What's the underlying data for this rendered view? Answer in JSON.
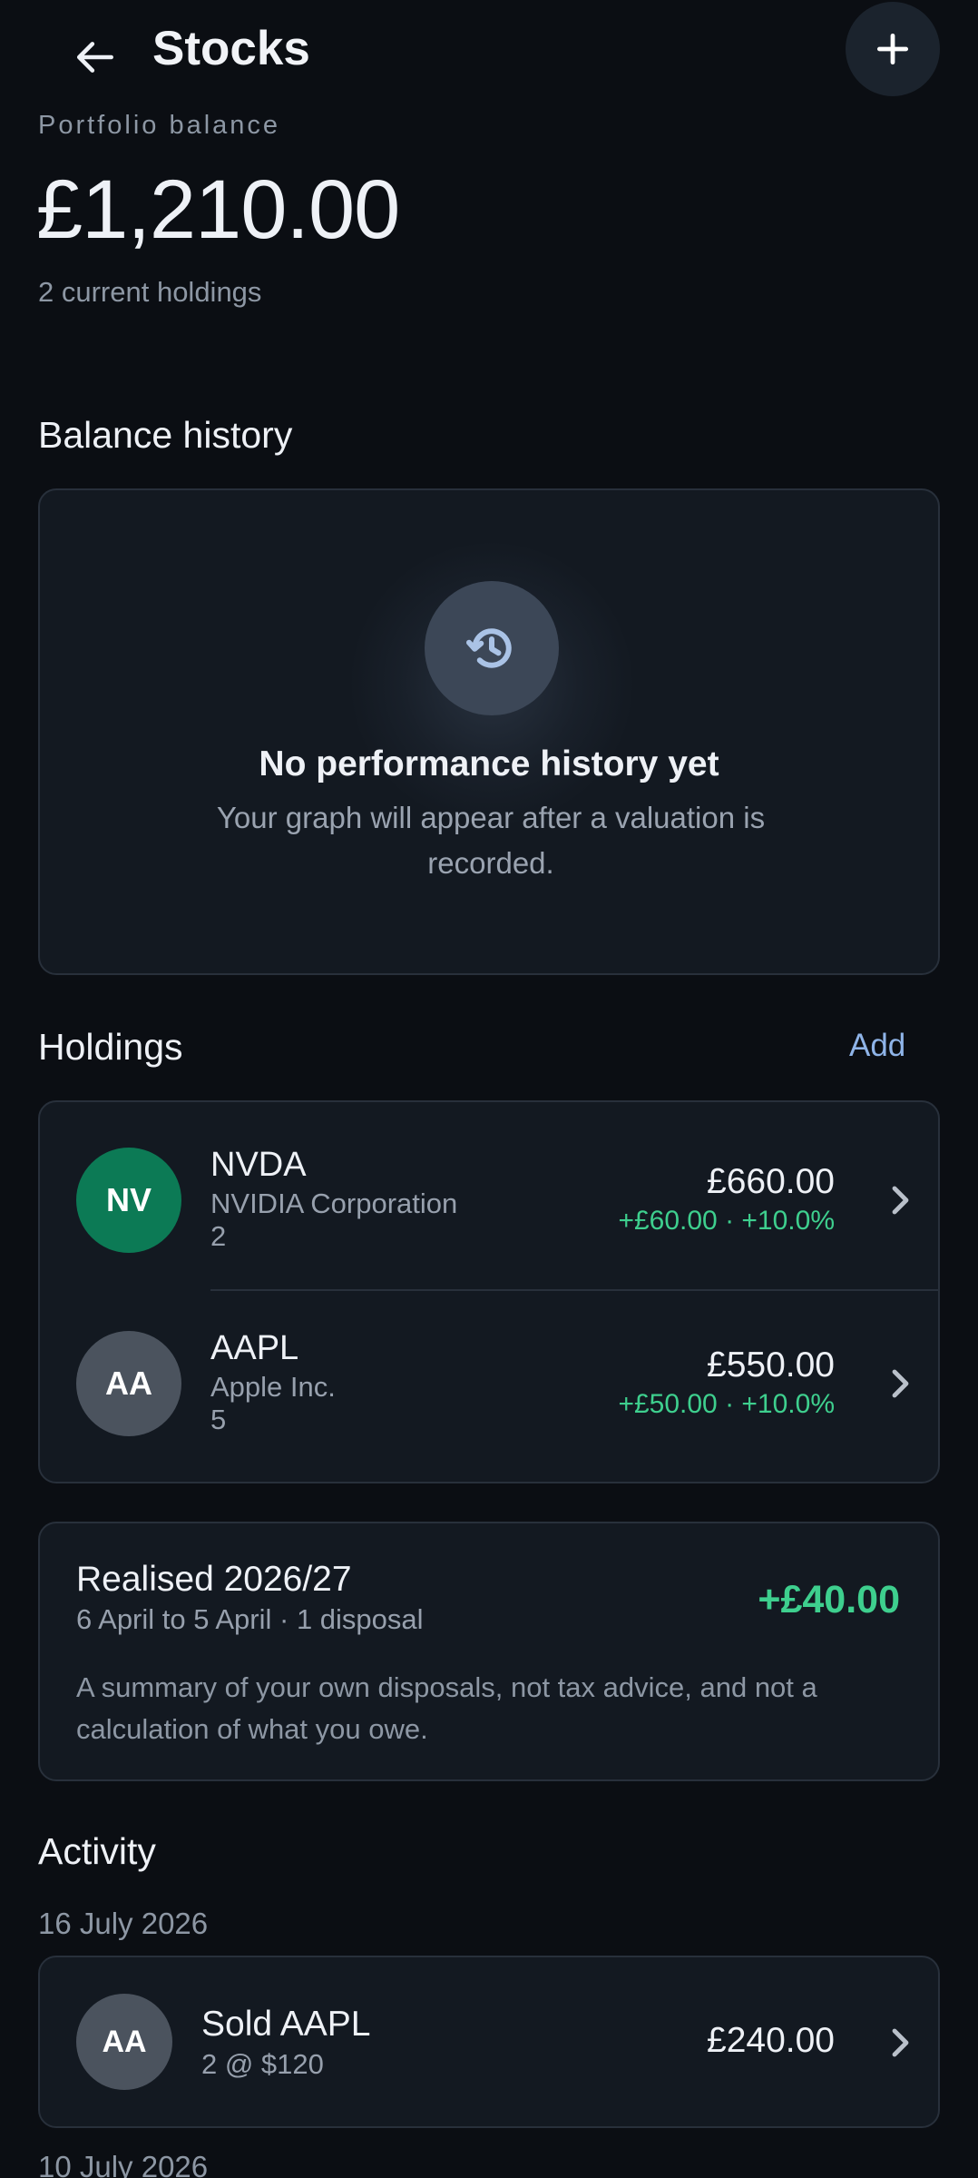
{
  "header": {
    "title": "Stocks",
    "back_icon": "arrow-left-icon",
    "add_icon": "plus-icon"
  },
  "portfolio": {
    "label": "Portfolio balance",
    "balance": "£1,210.00",
    "holdings_count": "2 current holdings"
  },
  "balance_history": {
    "section_title": "Balance history",
    "empty_icon": "history-icon",
    "empty_title": "No performance history yet",
    "empty_text": "Your graph will appear after a valuation is recorded."
  },
  "holdings": {
    "section_title": "Holdings",
    "add_label": "Add",
    "items": [
      {
        "initials": "NV",
        "avatar_color": "#0c7a55",
        "ticker": "NVDA",
        "name": "NVIDIA Corporation",
        "quantity": "2",
        "value": "£660.00",
        "change": "+£60.00 · +10.0%"
      },
      {
        "initials": "AA",
        "avatar_color": "#4b535e",
        "ticker": "AAPL",
        "name": "Apple Inc.",
        "quantity": "5",
        "value": "£550.00",
        "change": "+£50.00 · +10.0%"
      }
    ]
  },
  "realised": {
    "title": "Realised 2026/27",
    "subtitle": "6 April to 5 April · 1 disposal",
    "amount": "+£40.00",
    "note": "A summary of your own disposals, not tax advice, and not a calculation of what you owe."
  },
  "activity": {
    "section_title": "Activity",
    "groups": [
      {
        "date": "16 July 2026",
        "items": [
          {
            "initials": "AA",
            "title": "Sold AAPL",
            "subtitle": "2 @ $120",
            "amount": "£240.00"
          }
        ]
      },
      {
        "date": "10 July 2026",
        "items": []
      }
    ]
  },
  "colors": {
    "background": "#0b0e13",
    "card": "#131921",
    "positive": "#3ecf8e",
    "link": "#8fb4e8"
  }
}
